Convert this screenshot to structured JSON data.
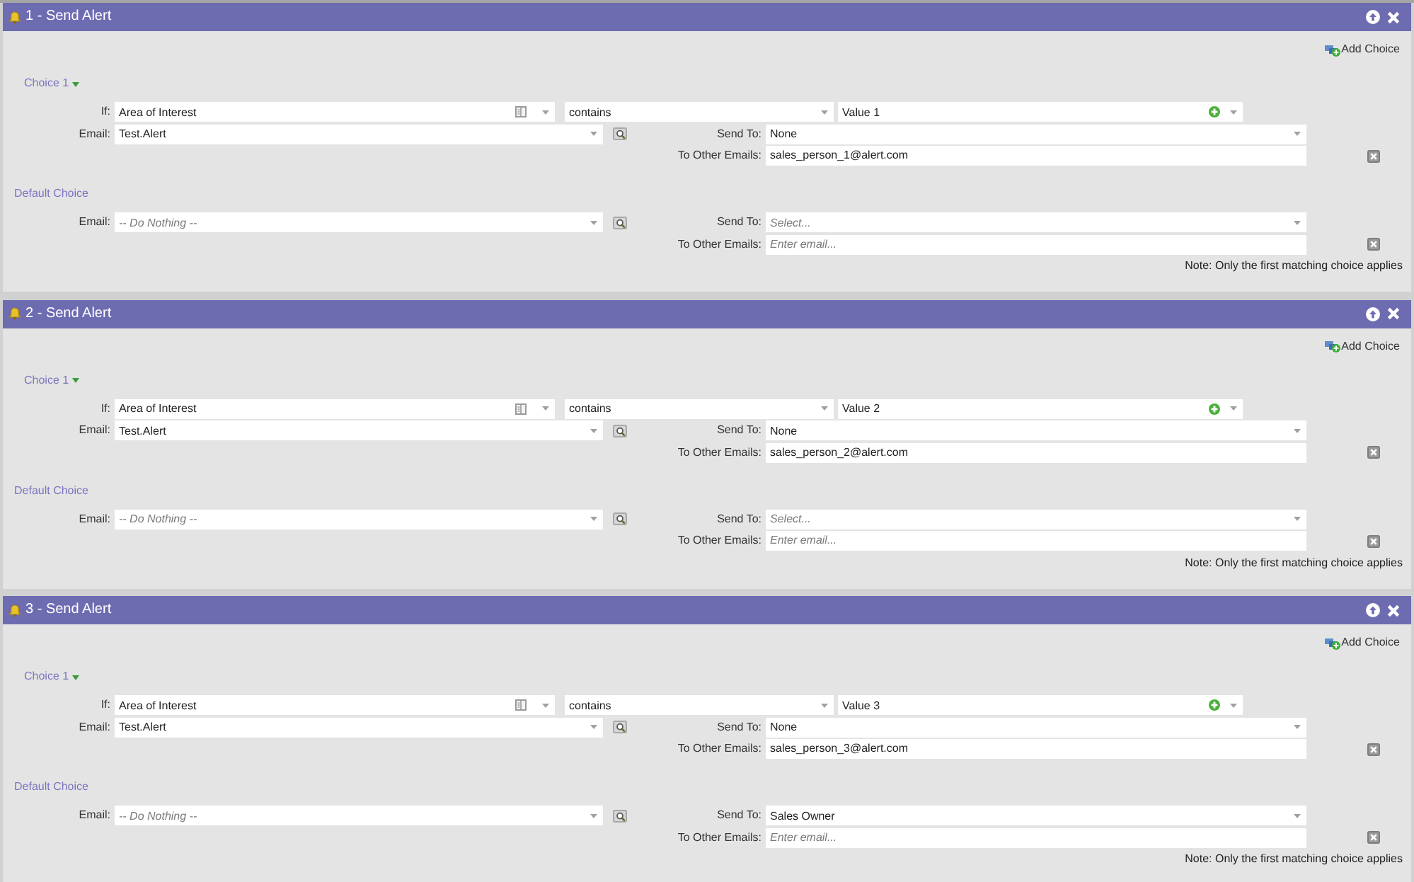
{
  "steps": [
    {
      "title": "1 - Send Alert",
      "add_choice": "Add Choice",
      "choices": [
        {
          "label": "Choice 1",
          "expanded": true,
          "if": {
            "label": "If:",
            "attribute": "Area of Interest",
            "operator": "contains",
            "value": "Value 1"
          },
          "email": {
            "label": "Email:",
            "value": "Test.Alert"
          },
          "send_to": {
            "label": "Send To:",
            "value": "None"
          },
          "other_emails": {
            "label": "To Other Emails:",
            "value": "sales_person_1@alert.com"
          }
        }
      ],
      "default_choice": {
        "label": "Default Choice",
        "email": {
          "label": "Email:",
          "placeholder": "-- Do Nothing --"
        },
        "send_to": {
          "label": "Send To:",
          "placeholder": "Select..."
        },
        "other_emails": {
          "label": "To Other Emails:",
          "placeholder": "Enter email..."
        }
      },
      "note": "Note: Only the first matching choice applies"
    },
    {
      "title": "2 - Send Alert",
      "add_choice": "Add Choice",
      "choices": [
        {
          "label": "Choice 1",
          "expanded": true,
          "if": {
            "label": "If:",
            "attribute": "Area of Interest",
            "operator": "contains",
            "value": "Value 2"
          },
          "email": {
            "label": "Email:",
            "value": "Test.Alert"
          },
          "send_to": {
            "label": "Send To:",
            "value": "None"
          },
          "other_emails": {
            "label": "To Other Emails:",
            "value": "sales_person_2@alert.com"
          }
        }
      ],
      "default_choice": {
        "label": "Default Choice",
        "email": {
          "label": "Email:",
          "placeholder": "-- Do Nothing --"
        },
        "send_to": {
          "label": "Send To:",
          "placeholder": "Select..."
        },
        "other_emails": {
          "label": "To Other Emails:",
          "placeholder": "Enter email..."
        }
      },
      "note": "Note: Only the first matching choice applies"
    },
    {
      "title": "3 - Send Alert",
      "add_choice": "Add Choice",
      "choices": [
        {
          "label": "Choice 1",
          "expanded": true,
          "if": {
            "label": "If:",
            "attribute": "Area of Interest",
            "operator": "contains",
            "value": "Value 3"
          },
          "email": {
            "label": "Email:",
            "value": "Test.Alert"
          },
          "send_to": {
            "label": "Send To:",
            "value": "None"
          },
          "other_emails": {
            "label": "To Other Emails:",
            "value": "sales_person_3@alert.com"
          }
        }
      ],
      "default_choice": {
        "label": "Default Choice",
        "email": {
          "label": "Email:",
          "placeholder": "-- Do Nothing --"
        },
        "send_to": {
          "label": "Send To:",
          "value": "Sales Owner"
        },
        "other_emails": {
          "label": "To Other Emails:",
          "placeholder": "Enter email..."
        }
      },
      "note": "Note: Only the first matching choice applies"
    }
  ]
}
